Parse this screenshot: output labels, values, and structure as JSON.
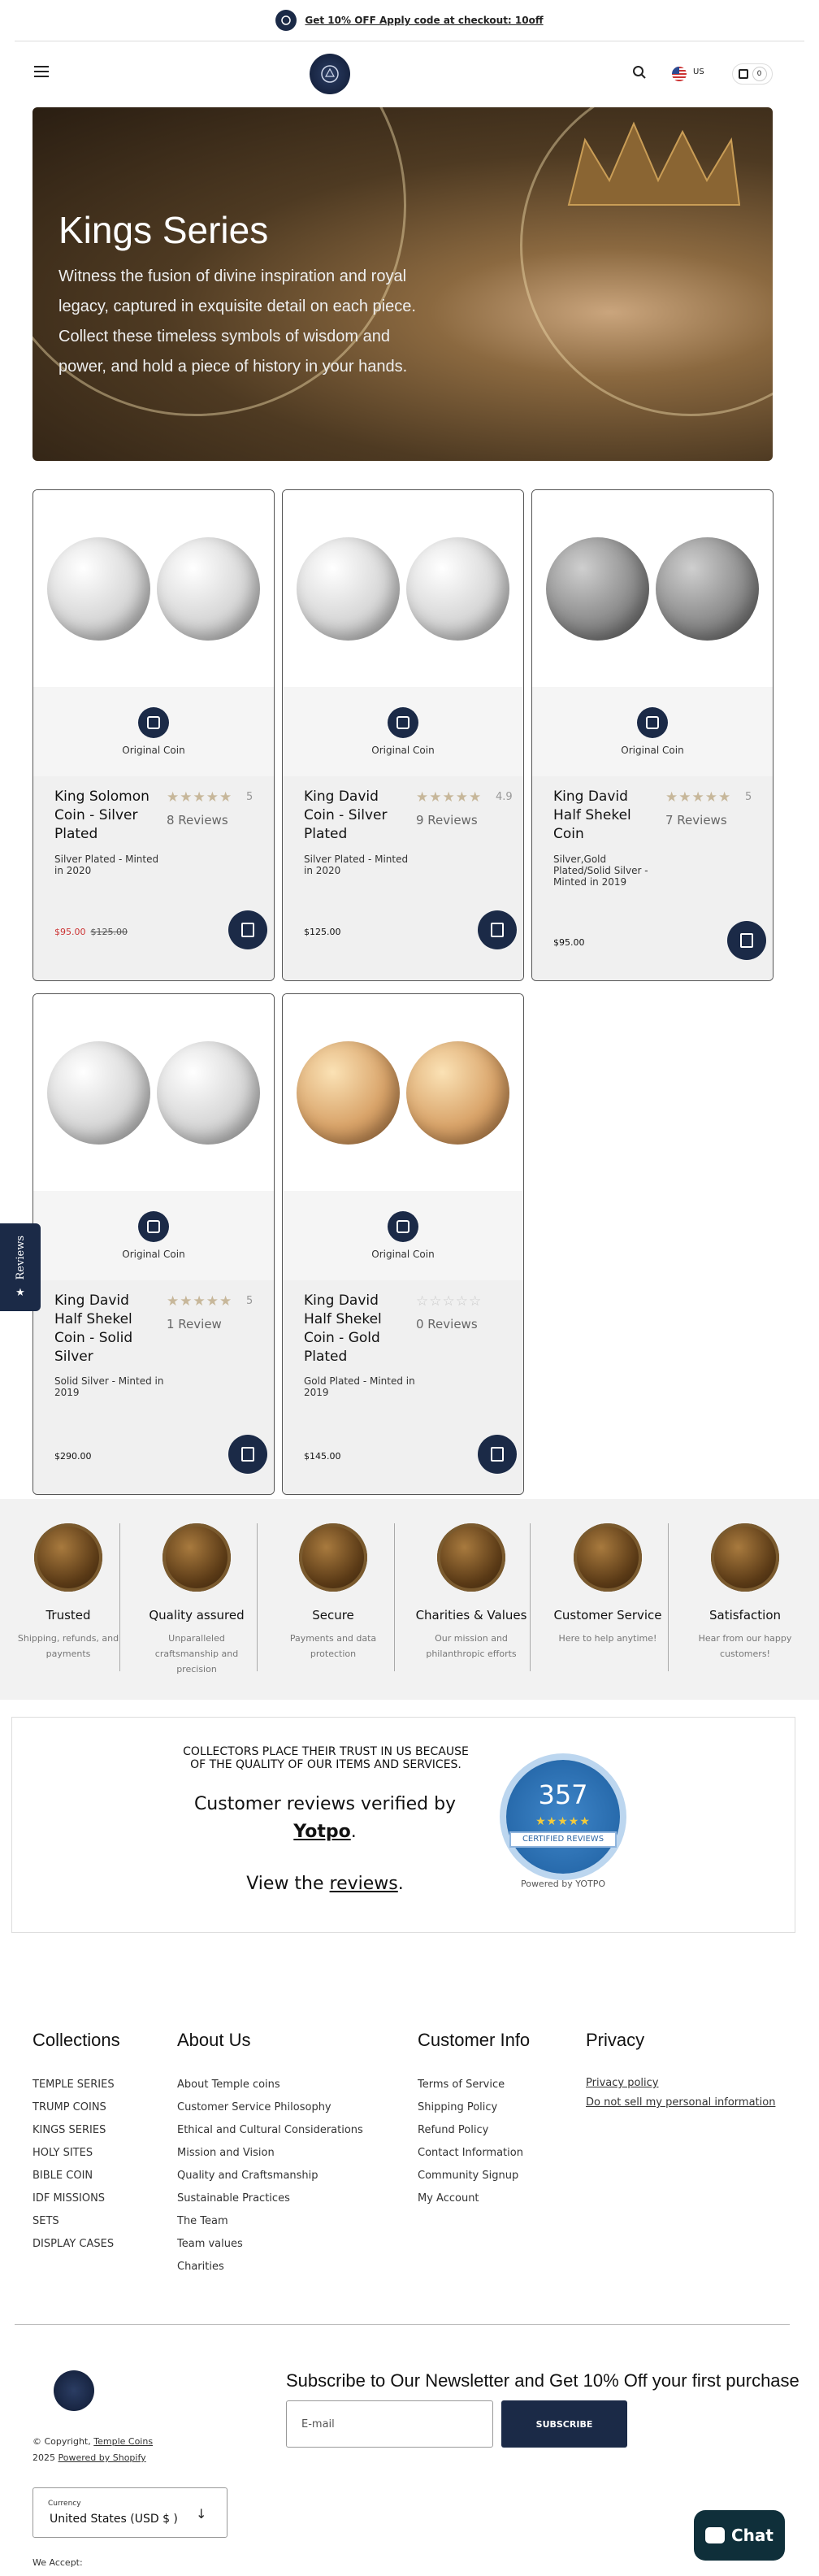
{
  "announcement": {
    "text": "Get 10% OFF Apply code at checkout: 10off"
  },
  "header": {
    "country": "US",
    "cart_count": "0"
  },
  "hero": {
    "title": "Kings Series",
    "description": "Witness the fusion of divine inspiration and royal legacy, captured in exquisite detail on each piece. Collect these timeless symbols of wisdom and power, and hold a piece of history in your hands."
  },
  "products": [
    {
      "name": "King Solomon Coin - Silver Plated",
      "stars": "★★★★★",
      "rating": "5",
      "reviews": "8 Reviews",
      "subtitle": "Silver Plated - Minted in 2020",
      "price": "$95.00",
      "compare": "$125.00",
      "badge": "Original Coin"
    },
    {
      "name": "King David Coin - Silver Plated",
      "stars": "★★★★★",
      "rating": "4.9",
      "reviews": "9 Reviews",
      "subtitle": "Silver Plated - Minted in 2020",
      "price": "$125.00",
      "badge": "Original Coin"
    },
    {
      "name": "King David Half Shekel Coin",
      "stars": "★★★★★",
      "rating": "5",
      "reviews": "7 Reviews",
      "subtitle": "Silver,Gold Plated/Solid Silver - Minted in 2019",
      "price": "$95.00",
      "badge": "Original Coin"
    },
    {
      "name": "King David Half Shekel Coin - Solid Silver",
      "stars": "★★★★★",
      "rating": "5",
      "reviews": "1 Review",
      "subtitle": "Solid Silver - Minted in 2019",
      "price": "$290.00",
      "badge": "Original Coin"
    },
    {
      "name": "King David Half Shekel Coin - Gold Plated",
      "stars": "☆☆☆☆☆",
      "rating": "",
      "reviews": "0 Reviews",
      "subtitle": "Gold Plated - Minted in 2019",
      "price": "$145.00",
      "badge": "Original Coin"
    }
  ],
  "reviews_tab": {
    "label": "Reviews"
  },
  "features": [
    {
      "title": "Trusted",
      "desc": "Shipping, refunds, and payments"
    },
    {
      "title": "Quality assured",
      "desc": "Unparalleled craftsmanship and precision"
    },
    {
      "title": "Secure",
      "desc": "Payments and data protection"
    },
    {
      "title": "Charities & Values",
      "desc": "Our mission and philanthropic efforts"
    },
    {
      "title": "Customer Service",
      "desc": "Here to help anytime!"
    },
    {
      "title": "Satisfaction",
      "desc": "Hear from our happy customers!"
    }
  ],
  "trust": {
    "line1": "COLLECTORS PLACE THEIR TRUST IN US BECAUSE OF THE QUALITY OF OUR ITEMS AND SERVICES.",
    "line2": "Customer reviews verified by",
    "yotpo": "Yotpo",
    "view_prefix": "View the",
    "view_link": "reviews",
    "seal_count": "357",
    "seal_stars": "★★★★★",
    "seal_label": "CERTIFIED REVIEWS",
    "powered": "Powered by YOTPO"
  },
  "footer": {
    "collections": {
      "title": "Collections",
      "links": [
        "TEMPLE SERIES",
        "TRUMP COINS",
        "KINGS SERIES",
        "HOLY SITES",
        "BIBLE COIN",
        "IDF MISSIONS",
        "SETS",
        "DISPLAY CASES"
      ]
    },
    "about": {
      "title": "About Us",
      "links": [
        "About Temple coins",
        "Customer Service Philosophy",
        "Ethical and Cultural Considerations",
        "Mission and Vision",
        "Quality and Craftsmanship",
        "Sustainable Practices",
        "The Team",
        "Team values",
        "Charities"
      ]
    },
    "info": {
      "title": "Customer Info",
      "links": [
        "Terms of Service",
        "Shipping Policy",
        "Refund Policy",
        "Contact Information",
        "Community Signup",
        "My Account"
      ]
    },
    "privacy": {
      "title": "Privacy",
      "links": [
        "Privacy policy",
        "Do not sell my personal information"
      ]
    },
    "copyright": "© Copyright,",
    "brand": "Temple Coins",
    "year_powered": "2025",
    "powered": "Powered by Shopify",
    "newsletter_title": "Subscribe to Our Newsletter and Get 10% Off your first purchase",
    "email_placeholder": "E-mail",
    "subscribe": "SUBSCRIBE",
    "currency_label": "Currency",
    "currency_value": "United States (USD $ )",
    "accept": "We Accept:"
  },
  "chat": {
    "label": "Chat"
  }
}
